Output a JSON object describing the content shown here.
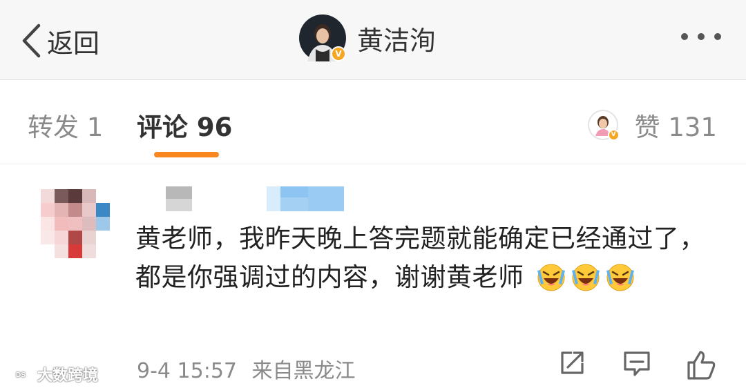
{
  "nav": {
    "back_label": "返回",
    "author_name": "黄洁洵",
    "verified_mark": "V",
    "more_icon": "more-dots-icon"
  },
  "tabs": {
    "repost": "转发 1",
    "comments": "评论 96",
    "likes": "赞 131",
    "active": "comments",
    "accent_color": "#f7871e"
  },
  "comment": {
    "text": "黄老师，我昨天晚上答完题就能确定已经通过了，都是你强调过的内容，谢谢黄老师",
    "emoji": [
      "laugh-cry-emoji",
      "laugh-cry-emoji",
      "laugh-cry-emoji"
    ],
    "time": "9-4 15:57",
    "source": "来自黑龙江",
    "actions": [
      "repost-icon",
      "comment-icon",
      "thumbs-up-icon"
    ]
  },
  "watermark": {
    "text": "大数跨境",
    "logo_text": "DS"
  },
  "colors": {
    "verified": "#f5a623",
    "text": "#222222",
    "muted": "#8a8a8a",
    "nav_bg": "#f7f7f7"
  }
}
